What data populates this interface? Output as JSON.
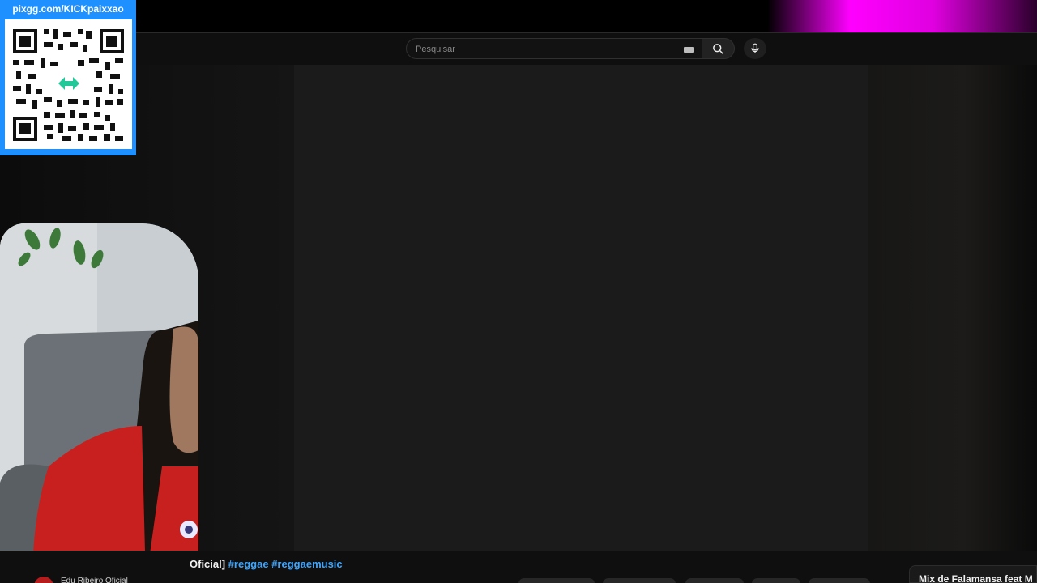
{
  "overlay": {
    "qr_url": "pixgg.com/KICKpaixxao"
  },
  "masthead": {
    "search_placeholder": "Pesquisar",
    "keyboard_icon": "keyboard-icon",
    "search_icon": "search-icon",
    "mic_icon": "microphone-icon"
  },
  "video": {
    "title_prefix": "Oficial]",
    "hashtags": [
      "#reggae",
      "#reggaemusic"
    ],
    "channel": "Edu Ribeiro Oficial"
  },
  "sidebar": {
    "mix_title": "Mix de Falamansa feat M"
  },
  "colors": {
    "accent_link": "#3ea6ff",
    "qr_frame": "#1e90ff",
    "stream_glow": "#ff00ff"
  }
}
